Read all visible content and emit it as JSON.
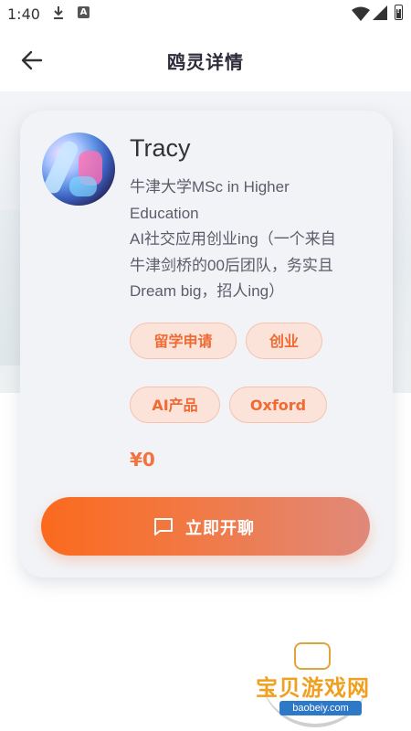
{
  "status_bar": {
    "time": "1:40"
  },
  "header": {
    "title": "鸥灵详情"
  },
  "profile": {
    "name": "Tracy",
    "description_lines": [
      "牛津大学MSc in Higher",
      "Education",
      "AI社交应用创业ing（一个来自",
      "牛津剑桥的00后团队，务实且",
      "Dream big，招人ing）"
    ],
    "tags": [
      "留学申请",
      "创业",
      "AI产品",
      "Oxford"
    ],
    "price": "¥0"
  },
  "actions": {
    "chat_label": "立即开聊"
  },
  "watermark": {
    "text": "宝贝游戏网",
    "url": "baobeiy.com"
  },
  "colors": {
    "accent": "#fb6a1e",
    "tag_bg": "#fbe3da",
    "tag_text": "#f06a32",
    "card_bg": "#f2f3f6"
  }
}
